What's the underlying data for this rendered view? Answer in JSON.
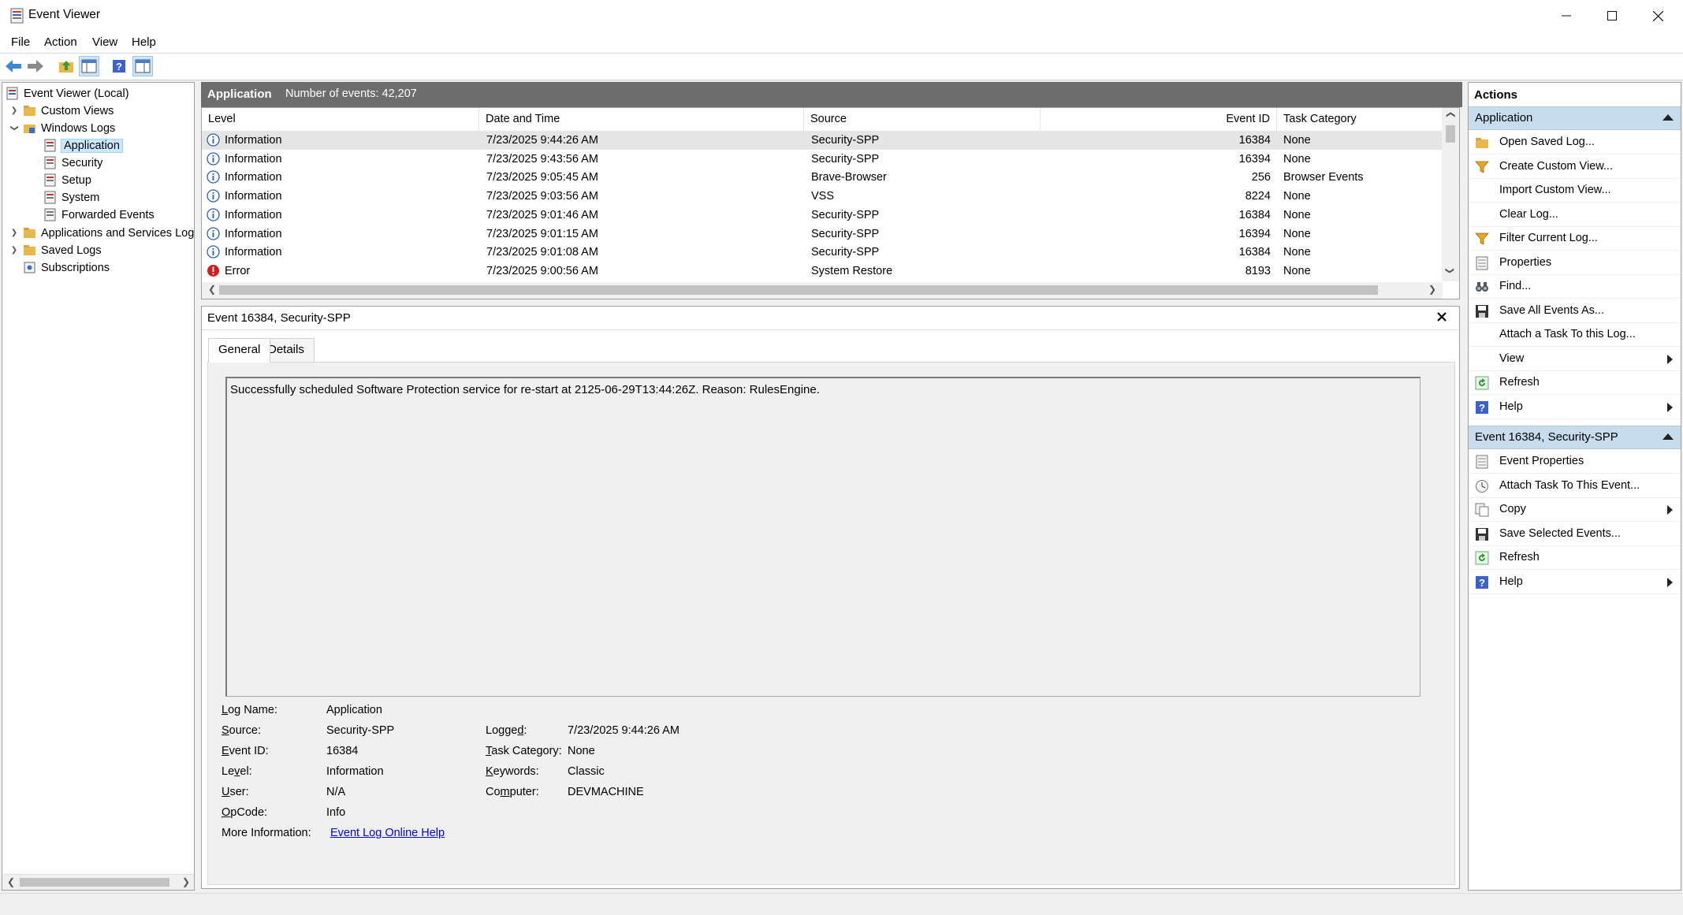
{
  "window": {
    "title": "Event Viewer"
  },
  "menu": [
    "File",
    "Action",
    "View",
    "Help"
  ],
  "tree": {
    "root": "Event Viewer (Local)",
    "items": [
      {
        "label": "Custom Views"
      },
      {
        "label": "Windows Logs"
      },
      {
        "label": "Application"
      },
      {
        "label": "Security"
      },
      {
        "label": "Setup"
      },
      {
        "label": "System"
      },
      {
        "label": "Forwarded Events"
      },
      {
        "label": "Applications and Services Logs"
      },
      {
        "label": "Saved Logs"
      },
      {
        "label": "Subscriptions"
      }
    ]
  },
  "grid": {
    "title": "Application",
    "count": "Number of events: 42,207",
    "columns": [
      "Level",
      "Date and Time",
      "Source",
      "Event ID",
      "Task Category"
    ],
    "rows": [
      {
        "level": "Information",
        "date": "7/23/2025 9:44:26 AM",
        "source": "Security-SPP",
        "id": "16384",
        "cat": "None"
      },
      {
        "level": "Information",
        "date": "7/23/2025 9:43:56 AM",
        "source": "Security-SPP",
        "id": "16394",
        "cat": "None"
      },
      {
        "level": "Information",
        "date": "7/23/2025 9:05:45 AM",
        "source": "Brave-Browser",
        "id": "256",
        "cat": "Browser Events"
      },
      {
        "level": "Information",
        "date": "7/23/2025 9:03:56 AM",
        "source": "VSS",
        "id": "8224",
        "cat": "None"
      },
      {
        "level": "Information",
        "date": "7/23/2025 9:01:46 AM",
        "source": "Security-SPP",
        "id": "16384",
        "cat": "None"
      },
      {
        "level": "Information",
        "date": "7/23/2025 9:01:15 AM",
        "source": "Security-SPP",
        "id": "16394",
        "cat": "None"
      },
      {
        "level": "Information",
        "date": "7/23/2025 9:01:08 AM",
        "source": "Security-SPP",
        "id": "16384",
        "cat": "None"
      },
      {
        "level": "Error",
        "date": "7/23/2025 9:00:56 AM",
        "source": "System Restore",
        "id": "8193",
        "cat": "None"
      }
    ]
  },
  "detail": {
    "title": "Event 16384, Security-SPP",
    "tabs": [
      "General",
      "Details"
    ],
    "description": "Successfully scheduled Software Protection service for re-start at 2125-06-29T13:44:26Z. Reason: RulesEngine.",
    "fields": {
      "log_name": {
        "label": "Log Name:",
        "value": "Application"
      },
      "source": {
        "label": "Source:",
        "value": "Security-SPP"
      },
      "event_id": {
        "label": "Event ID:",
        "value": "16384"
      },
      "level": {
        "label": "Level:",
        "value": "Information"
      },
      "user": {
        "label": "User:",
        "value": "N/A"
      },
      "opcode": {
        "label": "OpCode:",
        "value": "Info"
      },
      "more_info": {
        "label": "More Information:",
        "value": "Event Log Online Help"
      },
      "logged": {
        "label": "Logged:",
        "value": "7/23/2025 9:44:26 AM"
      },
      "task_category": {
        "label": "Task Category:",
        "value": "None"
      },
      "keywords": {
        "label": "Keywords:",
        "value": "Classic"
      },
      "computer": {
        "label": "Computer:",
        "value": "DEVMACHINE"
      }
    }
  },
  "actions": {
    "title": "Actions",
    "sections": [
      {
        "header": "Application",
        "items": [
          {
            "label": "Open Saved Log...",
            "icon": "folder-icon",
            "sub": false
          },
          {
            "label": "Create Custom View...",
            "icon": "filter-icon",
            "sub": false
          },
          {
            "label": "Import Custom View...",
            "icon": "",
            "sub": false
          },
          {
            "label": "Clear Log...",
            "icon": "",
            "sub": false
          },
          {
            "label": "Filter Current Log...",
            "icon": "filter-icon",
            "sub": false
          },
          {
            "label": "Properties",
            "icon": "properties-icon",
            "sub": false
          },
          {
            "label": "Find...",
            "icon": "binoculars-icon",
            "sub": false
          },
          {
            "label": "Save All Events As...",
            "icon": "save-icon",
            "sub": false
          },
          {
            "label": "Attach a Task To this Log...",
            "icon": "",
            "sub": false
          },
          {
            "label": "View",
            "icon": "",
            "sub": true
          },
          {
            "label": "Refresh",
            "icon": "refresh-icon",
            "sub": false
          },
          {
            "label": "Help",
            "icon": "help-icon",
            "sub": true
          }
        ]
      },
      {
        "header": "Event 16384, Security-SPP",
        "items": [
          {
            "label": "Event Properties",
            "icon": "properties-icon",
            "sub": false
          },
          {
            "label": "Attach Task To This Event...",
            "icon": "task-icon",
            "sub": false
          },
          {
            "label": "Copy",
            "icon": "copy-icon",
            "sub": true
          },
          {
            "label": "Save Selected Events...",
            "icon": "save-icon",
            "sub": false
          },
          {
            "label": "Refresh",
            "icon": "refresh-icon",
            "sub": false
          },
          {
            "label": "Help",
            "icon": "help-icon",
            "sub": true
          }
        ]
      }
    ]
  },
  "colors": {
    "accent": "#cce8ff",
    "header_bar": "#6d6d6d",
    "section": "#c7dced",
    "link": "#0000ee"
  }
}
